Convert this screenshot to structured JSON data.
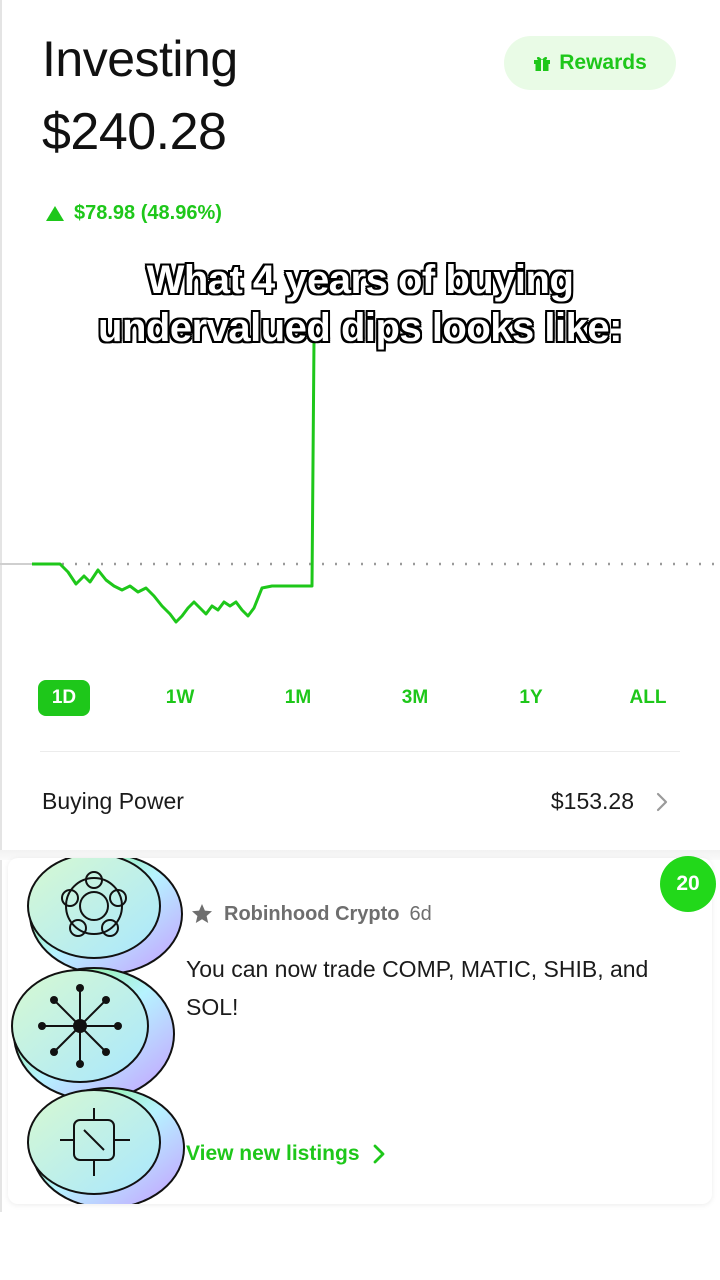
{
  "header": {
    "title": "Investing",
    "balance": "$240.28",
    "rewards_label": "Rewards",
    "change_text": "$78.98 (48.96%)"
  },
  "overlay": {
    "caption_line1": "What 4 years of buying",
    "caption_line2": "undervalued dips looks like:"
  },
  "colors": {
    "accent": "#1ec71a",
    "badge": "#22d81a",
    "text": "#1b1b1b",
    "muted": "#6e6e6e"
  },
  "ranges": {
    "items": [
      "1D",
      "1W",
      "1M",
      "3M",
      "1Y",
      "ALL"
    ],
    "active": "1D"
  },
  "buying_power": {
    "label": "Buying Power",
    "value": "$153.28"
  },
  "card": {
    "badge_count": "20",
    "source": "Robinhood Crypto",
    "time": "6d",
    "message": "You can now trade COMP, MATIC, SHIB, and SOL!",
    "cta": "View new listings",
    "icons": [
      "star-icon",
      "chevron-right-icon",
      "gift-icon"
    ]
  }
}
